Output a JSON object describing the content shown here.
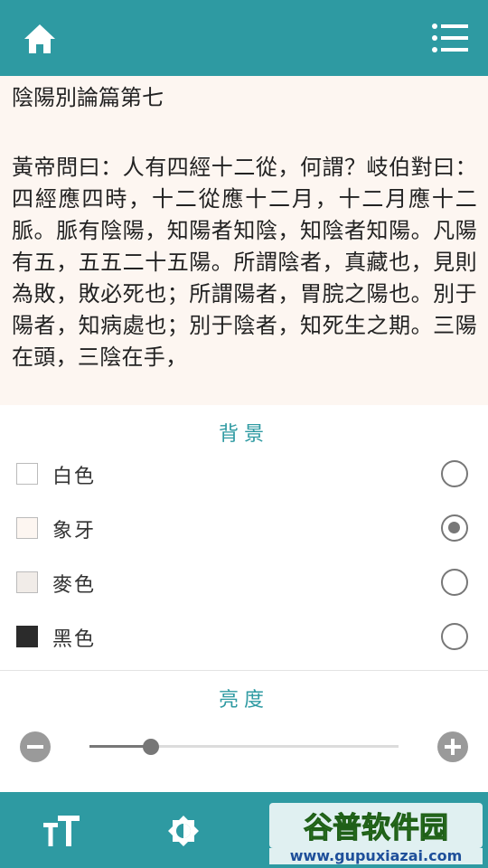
{
  "topbar": {
    "home_icon": "home-icon",
    "menu_icon": "list-menu-icon"
  },
  "reader": {
    "chapter_title": "陰陽別論篇第七",
    "text": "黃帝問曰：人有四經十二從，何謂？岐伯對曰：四經應四時，十二從應十二月，十二月應十二脈。脈有陰陽，知陽者知陰，知陰者知陽。凡陽有五，五五二十五陽。所謂陰者，真藏也，見則為敗，敗必死也；所謂陽者，胃脘之陽也。別于陽者，知病處也；別于陰者，知死生之期。三陽在頭，三陰在手，"
  },
  "settings": {
    "background_title": "背景",
    "options": [
      {
        "label": "白色",
        "color": "#ffffff",
        "selected": false
      },
      {
        "label": "象牙",
        "color": "#fdf6f1",
        "selected": true
      },
      {
        "label": "麥色",
        "color": "#f1ece8",
        "selected": false
      },
      {
        "label": "黑色",
        "color": "#2b2b2b",
        "selected": false
      }
    ],
    "brightness_title": "亮度",
    "brightness_value": 0.2
  },
  "bottombar": {
    "font_icon": "font-size-icon",
    "brightness_icon": "brightness-icon"
  },
  "watermark": {
    "text": "谷普软件园",
    "url": "www.gupuxiazai.com"
  },
  "colors": {
    "accent": "#2e9aa2",
    "reader_bg": "#fdf6f1"
  }
}
